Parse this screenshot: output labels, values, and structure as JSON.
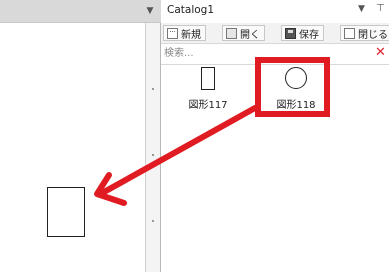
{
  "panel": {
    "title": "Catalog1",
    "toolbar": [
      {
        "label": "新規"
      },
      {
        "label": "開く"
      },
      {
        "label": "保存"
      },
      {
        "label": "閉じる"
      }
    ],
    "search": {
      "placeholder": "検索..."
    },
    "items": [
      {
        "label": "図形117",
        "shape": "rectangle"
      },
      {
        "label": "図形118",
        "shape": "circle"
      }
    ]
  },
  "annotation": {
    "color": "#e01b22"
  },
  "icons": [
    "dropdown-arrow-icon",
    "pin-icon",
    "new-icon",
    "open-icon",
    "save-icon",
    "close-catalog-icon",
    "clear-search-icon"
  ]
}
